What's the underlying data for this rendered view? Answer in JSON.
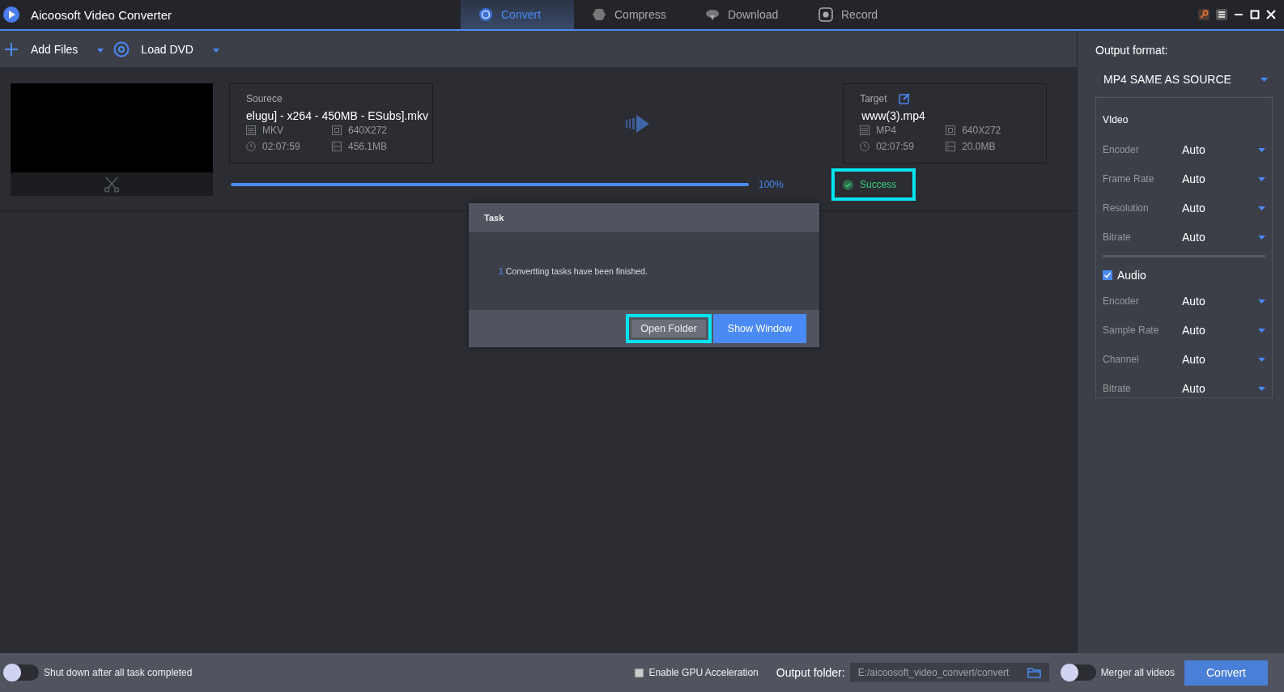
{
  "app": {
    "title": "Aicoosoft Video Converter"
  },
  "tabs": [
    {
      "label": "Convert",
      "selected": true,
      "kind": "convert"
    },
    {
      "label": "Compress",
      "selected": false,
      "kind": "compress"
    },
    {
      "label": "Download",
      "selected": false,
      "kind": "download"
    },
    {
      "label": "Record",
      "selected": false,
      "kind": "record"
    }
  ],
  "toolbar": [
    {
      "label": "Add Files",
      "kind": "add"
    },
    {
      "label": "Load DVD",
      "kind": "dvd"
    }
  ],
  "source": {
    "heading": "Sourece",
    "name": "elugu] - x264 - 450MB - ESubs].mkv",
    "format": "MKV",
    "resolution": "640X272",
    "duration": "02:07:59",
    "size": "456.1MB"
  },
  "target": {
    "heading": "Target",
    "name": "www(3).mp4",
    "format": "MP4",
    "resolution": "640X272",
    "duration": "02:07:59",
    "size": "20.0MB"
  },
  "progress": {
    "level": 1,
    "reading": "100%"
  },
  "status": {
    "label": "Success",
    "highlighted": true
  },
  "dialog": {
    "title": "Task",
    "count": "1",
    "message": "Convertting tasks have been finished.",
    "buttons": [
      {
        "label": "Open Folder",
        "kind": "secondary",
        "highlighted": true
      },
      {
        "label": "Show Window",
        "kind": "primary",
        "highlighted": false
      }
    ]
  },
  "output": {
    "label": "Output format:",
    "format": "MP4 SAME AS SOURCE"
  },
  "video": {
    "heading": "VIdeo",
    "settings": [
      {
        "label": "Encoder",
        "value": "Auto"
      },
      {
        "label": "Frame Rate",
        "value": "Auto"
      },
      {
        "label": "Resolution",
        "value": "Auto"
      },
      {
        "label": "Bitrate",
        "value": "Auto"
      }
    ]
  },
  "audio": {
    "heading": "Audio",
    "checked": true,
    "settings": [
      {
        "label": "Encoder",
        "value": "Auto"
      },
      {
        "label": "Sample Rate",
        "value": "Auto"
      },
      {
        "label": "Channel",
        "value": "Auto"
      },
      {
        "label": "Bitrate",
        "value": "Auto"
      }
    ]
  },
  "bottom": {
    "shutdown": {
      "label": "Shut down after all task completed",
      "on": false
    },
    "gpu": {
      "label": "Enable GPU Acceleration",
      "checked": false
    },
    "folder": {
      "label": "Output folder:",
      "value": "E:/aicoosoft_video_convert/convert"
    },
    "merge": {
      "label": "Merger all videos",
      "on": false
    },
    "convert": "Convert"
  }
}
